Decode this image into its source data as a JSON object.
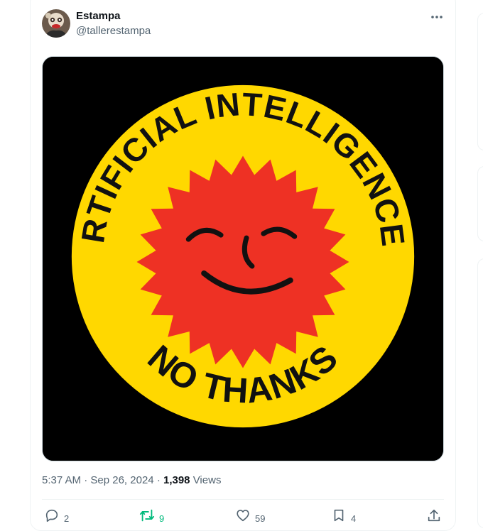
{
  "author": {
    "name": "Estampa",
    "handle": "@tallerestampa"
  },
  "media": {
    "top_text": "ARTIFICIAL INTELLIGENCE?",
    "bottom_text": "NO THANKS",
    "colors": {
      "background": "#000000",
      "disc": "#ffd800",
      "sun": "#ee3124",
      "ink": "#111111"
    }
  },
  "meta": {
    "time": "5:37 AM",
    "separator": "·",
    "date": "Sep 26, 2024",
    "views_count": "1,398",
    "views_label": "Views"
  },
  "actions": {
    "replies": "2",
    "reposts": "9",
    "likes": "59",
    "bookmarks": "4"
  },
  "icons": [
    "more-icon",
    "reply-icon",
    "repost-icon",
    "like-icon",
    "bookmark-icon",
    "share-icon"
  ],
  "accent_colors": {
    "repost_active": "#00ba7c",
    "secondary_text": "#536471"
  }
}
